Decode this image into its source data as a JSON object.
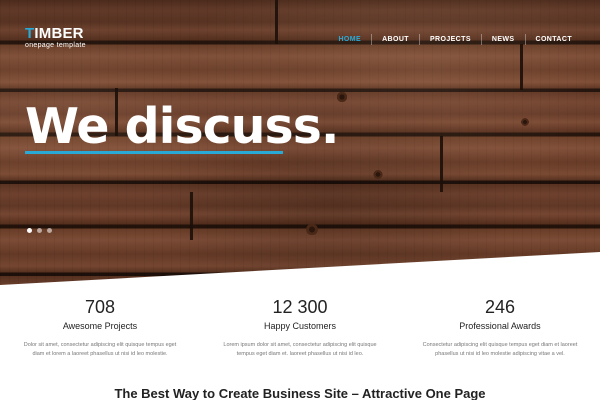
{
  "brand": {
    "title_first": "T",
    "title_rest": "IMBER",
    "subtitle": "onepage template",
    "accent_color": "#29a9d6"
  },
  "nav": {
    "items": [
      {
        "label": "HOME",
        "active": true
      },
      {
        "label": "ABOUT",
        "active": false
      },
      {
        "label": "PROJECTS",
        "active": false
      },
      {
        "label": "NEWS",
        "active": false
      },
      {
        "label": "CONTACT",
        "active": false
      }
    ]
  },
  "hero": {
    "headline": "We discuss.",
    "slides_total": 3,
    "slide_active": 1
  },
  "stats": [
    {
      "number": "708",
      "title": "Awesome Projects",
      "desc": "Dolor sit amet, consectetur adipiscing elit quisque tempus eget diam et lorem a laoreet phasellus ut nisi id leo molestie."
    },
    {
      "number": "12 300",
      "title": "Happy Customers",
      "desc": "Lorem ipsum dolor sit amet, consectetur adipiscing elit quisque tempus eget diam et. laoreet phasellus ut nisi id leo."
    },
    {
      "number": "246",
      "title": "Professional Awards",
      "desc": "Consectetur adipiscing elit quisque tempus eget diam et laoreet phasellus ut nisi id leo molestie adipiscing vitae a vel."
    }
  ],
  "section": {
    "title": "The Best Way to Create Business Site – Attractive One Page"
  }
}
